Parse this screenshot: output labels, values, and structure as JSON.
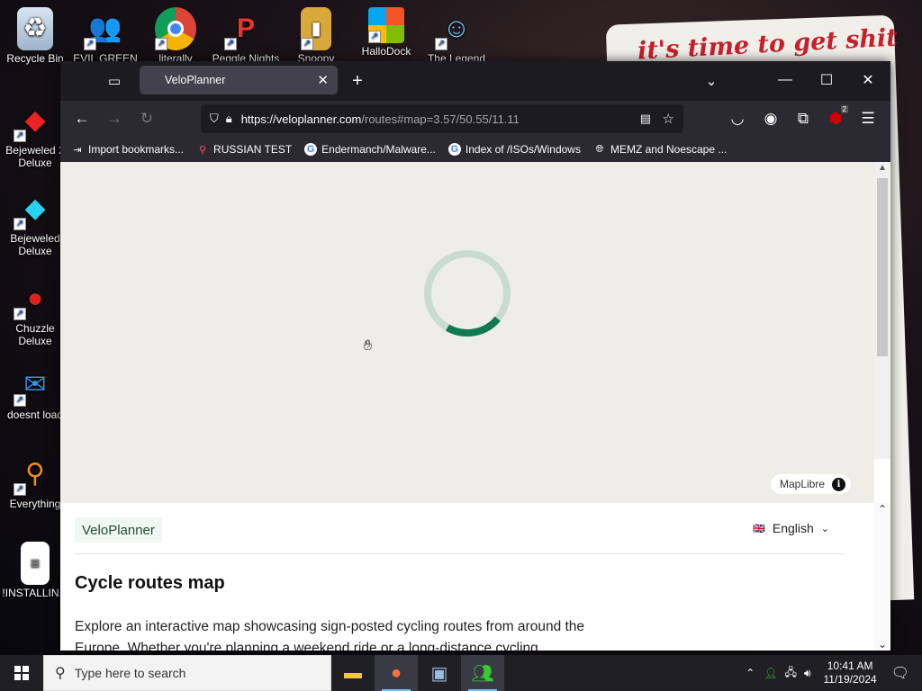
{
  "desktop": {
    "icons": [
      {
        "label": "Recycle Bin"
      },
      {
        "label": "Bejeweled 2 Deluxe"
      },
      {
        "label": "Bejeweled Deluxe"
      },
      {
        "label": "Chuzzle Deluxe"
      },
      {
        "label": "doesnt load"
      },
      {
        "label": "Everything"
      },
      {
        "label": "!INSTALLIN..."
      }
    ],
    "top_icons": [
      {
        "label": "EVIL GREEN"
      },
      {
        "label": "literally"
      },
      {
        "label": "Peggle Nights"
      },
      {
        "label": "Snoopy"
      },
      {
        "label": "HalloDock"
      },
      {
        "label": "The Legend"
      }
    ],
    "banner_text": "it's time to get shit"
  },
  "browser": {
    "tab_title": "VeloPlanner",
    "url_host": "https://veloplanner.com",
    "url_path": "/routes#map=3.57/50.55/11.11",
    "notification_badge": "2",
    "bookmarks": [
      {
        "label": "Import bookmarks..."
      },
      {
        "label": "RUSSIAN TEST"
      },
      {
        "label": "Endermanch/Malware..."
      },
      {
        "label": "Index of /ISOs/Windows"
      },
      {
        "label": "MEMZ and Noescape ..."
      }
    ]
  },
  "map": {
    "attribution": "MapLibre",
    "info_symbol": "i",
    "spinner_color": "#0f7a4f"
  },
  "page": {
    "brand": "VeloPlanner",
    "language": "English",
    "title": "Cycle routes map",
    "description": "Explore an interactive map showcasing sign-posted cycling routes from around the Europe. Whether you're planning a weekend ride or a long-distance cycling"
  },
  "taskbar": {
    "search_placeholder": "Type here to search",
    "time": "10:41 AM",
    "date": "11/19/2024"
  }
}
